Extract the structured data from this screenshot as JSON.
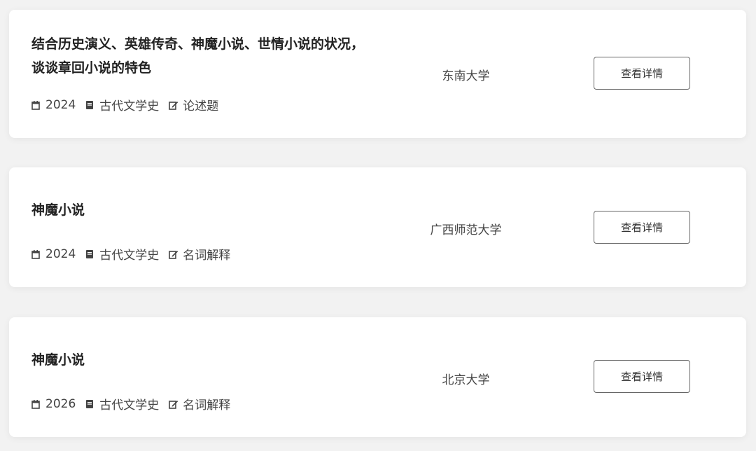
{
  "questions": [
    {
      "title": "结合历史演义、英雄传奇、神魔小说、世情小说的状况，谈谈章回小说的特色",
      "year": "2024",
      "course": "古代文学史",
      "type": "论述题",
      "school": "东南大学",
      "button_label": "查看详情"
    },
    {
      "title": "神魔小说",
      "year": "2024",
      "course": "古代文学史",
      "type": "名词解释",
      "school": "广西师范大学",
      "button_label": "查看详情"
    },
    {
      "title": "神魔小说",
      "year": "2026",
      "course": "古代文学史",
      "type": "名词解释",
      "school": "北京大学",
      "button_label": "查看详情"
    }
  ],
  "icons": {
    "year": "calendar-icon",
    "course": "book-icon",
    "type": "edit-icon"
  }
}
